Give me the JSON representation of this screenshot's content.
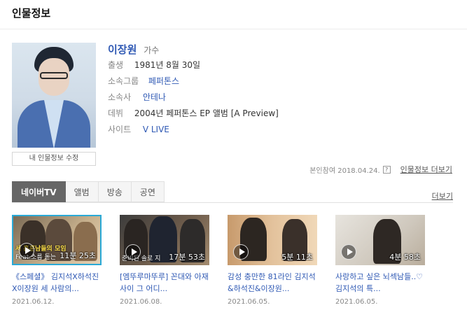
{
  "section_title": "인물정보",
  "profile": {
    "name": "이장원",
    "role": "가수",
    "edit_button": "내 인물정보 수정",
    "rows": [
      {
        "label": "출생",
        "value": "1981년 8월 30일"
      },
      {
        "label": "소속그룹",
        "value": "페퍼톤스"
      },
      {
        "label": "소속사",
        "value": "안테나"
      },
      {
        "label": "데뷔",
        "value": "2004년 페퍼톤스 EP 앨범 [A Preview]"
      },
      {
        "label": "사이트",
        "value": "V LIVE"
      }
    ],
    "source": "본인참여 2018.04.24.",
    "help_icon": "?",
    "more_info": "인물정보 더보기"
  },
  "tabs": {
    "items": [
      "네이버TV",
      "앨범",
      "방송",
      "공연"
    ],
    "active": "네이버TV",
    "more": "더보기"
  },
  "videos": [
    {
      "title": "《스페셜》 김지석X하석진X이장원 세 사람의...",
      "date": "2021.06.12.",
      "duration": "11분 25초",
      "overlay1": "세 훈훈남들의 모임",
      "overlay2": "Feat.소름 돋는"
    },
    {
      "title": "[엠뚜루마뚜루] 꼰대와 아재 사이 그 어디...",
      "date": "2021.06.08.",
      "duration": "17분 53초",
      "overlay1": "",
      "overlay2": "준비된 솔로 지"
    },
    {
      "title": "감성 충만한 81라인 김지석&하석진&이장원...",
      "date": "2021.06.05.",
      "duration": "5분 11초",
      "overlay1": "",
      "overlay2": ""
    },
    {
      "title": "사랑하고 싶은 뇌섹남들..♡ 김지석의 특...",
      "date": "2021.06.05.",
      "duration": "4분 58초",
      "overlay1": "",
      "overlay2": ""
    }
  ],
  "colors": {
    "link": "#2f59b4",
    "tab_active": "#666666",
    "thumb_border": "#2aa9d6"
  }
}
